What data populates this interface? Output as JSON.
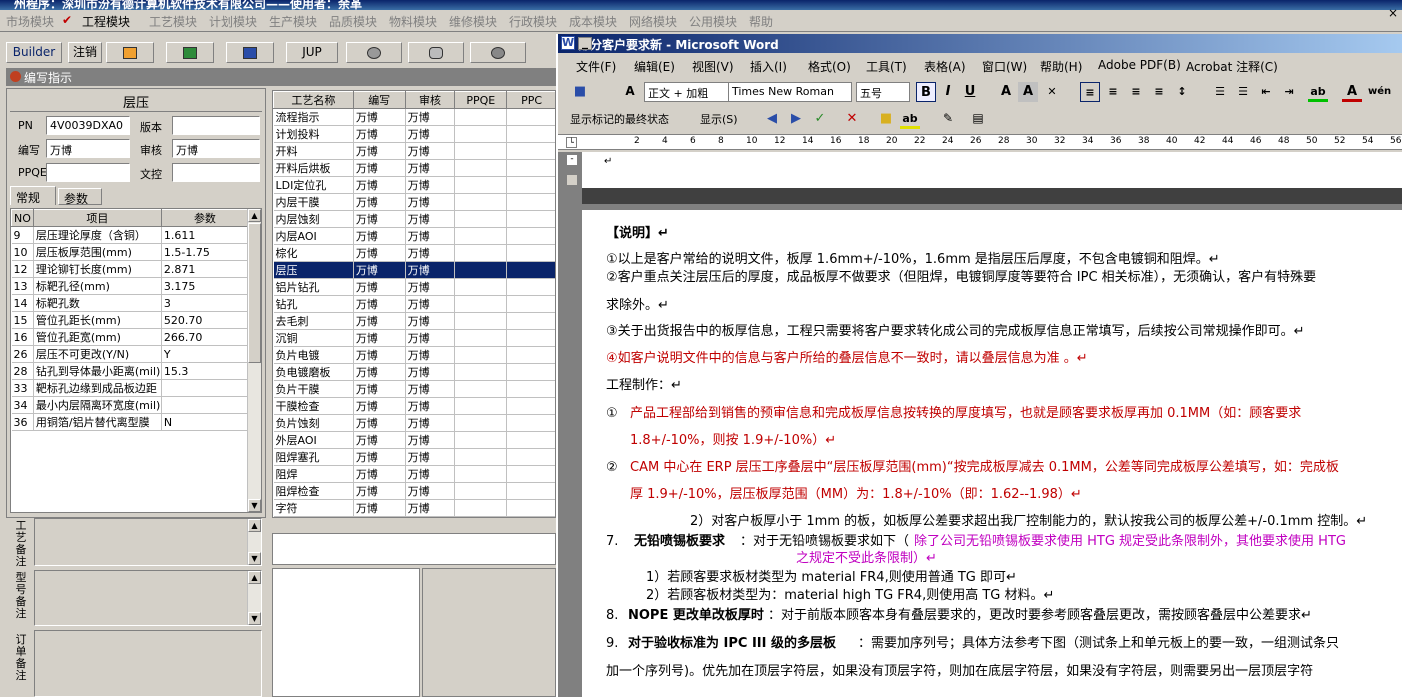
{
  "app": {
    "title": "州程序：深圳市汾有德计算机软件技术有限公司——使用者：余革",
    "menu": [
      "市场模块",
      "工程模块",
      "工艺模块",
      "计划模块",
      "生产模块",
      "品质模块",
      "物料模块",
      "维修模块",
      "行政模块",
      "成本模块",
      "网络模块",
      "公用模块",
      "帮助"
    ],
    "checked_menu": "✔",
    "toolbar": [
      "Builder",
      "注销",
      "",
      "",
      "",
      "JUP",
      "",
      "",
      ""
    ],
    "panel_title": "编写指示",
    "section_title": "层压",
    "form": {
      "pn_label": "PN",
      "pn_value": "4V0039DXA0",
      "version_label": "版本",
      "version_value": "",
      "writer_label": "编写",
      "writer_value": "万博",
      "review_label": "审核",
      "review_value": "万博",
      "ppqe_label": "PPQE",
      "ppqe_value": "",
      "doc_label": "文控",
      "doc_value": ""
    },
    "tabs": [
      "常规",
      "参数"
    ],
    "params_headers": [
      "NO",
      "项目",
      "参数"
    ],
    "params": [
      {
        "no": "9",
        "item": "层压理论厚度（含铜）",
        "value": "1.611"
      },
      {
        "no": "10",
        "item": "层压板厚范围(mm)",
        "value": "1.5-1.75"
      },
      {
        "no": "12",
        "item": "理论铆钉长度(mm)",
        "value": "2.871"
      },
      {
        "no": "13",
        "item": "标靶孔径(mm)",
        "value": "3.175"
      },
      {
        "no": "14",
        "item": "标靶孔数",
        "value": "3"
      },
      {
        "no": "15",
        "item": "管位孔距长(mm)",
        "value": "520.70"
      },
      {
        "no": "16",
        "item": "管位孔距宽(mm)",
        "value": "266.70"
      },
      {
        "no": "26",
        "item": "层压不可更改(Y/N)",
        "value": "Y"
      },
      {
        "no": "28",
        "item": "钻孔到导体最小距离(mil)",
        "value": "15.3"
      },
      {
        "no": "33",
        "item": "靶标孔边缘到成品板边距",
        "value": ""
      },
      {
        "no": "34",
        "item": "最小内层隔离环宽度(mil)",
        "value": ""
      },
      {
        "no": "36",
        "item": "用铜箔/铝片替代离型膜",
        "value": "N"
      }
    ],
    "memo_labels": [
      "工艺备注",
      "型号备注",
      "订单备注"
    ],
    "process_headers": [
      "工艺名称",
      "编写",
      "审核",
      "PPQE",
      "PPC"
    ],
    "process_rows": [
      [
        "流程指示",
        "万博",
        "万博"
      ],
      [
        "计划投料",
        "万博",
        "万博"
      ],
      [
        "开料",
        "万博",
        "万博"
      ],
      [
        "开料后烘板",
        "万博",
        "万博"
      ],
      [
        "LDI定位孔",
        "万博",
        "万博"
      ],
      [
        "内层干膜",
        "万博",
        "万博"
      ],
      [
        "内层蚀刻",
        "万博",
        "万博"
      ],
      [
        "内层AOI",
        "万博",
        "万博"
      ],
      [
        "棕化",
        "万博",
        "万博"
      ],
      [
        "层压",
        "万博",
        "万博"
      ],
      [
        "铝片钻孔",
        "万博",
        "万博"
      ],
      [
        "钻孔",
        "万博",
        "万博"
      ],
      [
        "去毛刺",
        "万博",
        "万博"
      ],
      [
        "沉铜",
        "万博",
        "万博"
      ],
      [
        "负片电镀",
        "万博",
        "万博"
      ],
      [
        "负电镀磨板",
        "万博",
        "万博"
      ],
      [
        "负片干膜",
        "万博",
        "万博"
      ],
      [
        "干膜检查",
        "万博",
        "万博"
      ],
      [
        "负片蚀刻",
        "万博",
        "万博"
      ],
      [
        "外层AOI",
        "万博",
        "万博"
      ],
      [
        "阻焊塞孔",
        "万博",
        "万博"
      ],
      [
        "阻焊",
        "万博",
        "万博"
      ],
      [
        "阻焊检查",
        "万博",
        "万博"
      ],
      [
        "字符",
        "万博",
        "万博"
      ]
    ],
    "selected_row": 9
  },
  "word": {
    "title": "部分客户要求新 - Microsoft Word",
    "menu": [
      "文件(F)",
      "编辑(E)",
      "视图(V)",
      "插入(I)",
      "格式(O)",
      "工具(T)",
      "表格(A)",
      "窗口(W)",
      "帮助(H)",
      "Adobe PDF(B)",
      "Acrobat 注释(C)"
    ],
    "style_value": "正文 + 加粗",
    "font_value": "Times New Roman",
    "size_value": "五号",
    "markup_value": "显示标记的最终状态",
    "show_label": "显示(S)",
    "ruler": [
      "2",
      "4",
      "6",
      "8",
      "10",
      "12",
      "14",
      "16",
      "18",
      "20",
      "22",
      "24",
      "26",
      "28",
      "30",
      "32",
      "34",
      "36",
      "38",
      "40",
      "42",
      "44",
      "46",
      "48",
      "50",
      "52",
      "54",
      "56"
    ],
    "colors": {
      "red": "#c00000",
      "magenta": "#c000c0"
    },
    "lines": {
      "l1": "【说明】↵",
      "l2": "①以上是客户常给的说明文件，板厚 1.6mm+/-10%，1.6mm 是指层压后厚度，不包含电镀铜和阻焊。↵",
      "l3": "②客户重点关注层压后的厚度，成品板厚不做要求（但阻焊，电镀铜厚度等要符合 IPC 相关标准），无须确认，客户有特殊要",
      "l4": "求除外。↵",
      "l5": "③关于出货报告中的板厚信息，工程只需要将客户要求转化成公司的完成板厚信息正常填写，后续按公司常规操作即可。↵",
      "l6": "④如客户说明文件中的信息与客户所给的叠层信息不一致时，请以叠层信息为准 。↵",
      "l7": "工程制作：↵",
      "l8a": "①",
      "l8b": "产品工程部给到销售的预审信息和完成板厚信息按转换的厚度填写，也就是顾客要求板厚再加 0.1MM（如：顾客要求",
      "l9": "1.8+/-10%，则按 1.9+/-10%）↵",
      "l10a": "②",
      "l10b": "CAM 中心在 ERP 层压工序叠层中“层压板厚范围(mm)“按完成板厚减去 0.1MM，公差等同完成板厚公差填写，如：完成板",
      "l11": "厚 1.9+/-10%，层压板厚范围（MM）为：1.8+/-10%（即：1.62--1.98）↵",
      "l12": "2）对客户板厚小于 1mm 的板，如板厚公差要求超出我厂控制能力的，默认按我公司的板厚公差+/-0.1mm 控制。↵",
      "l13a": "7.",
      "l13b": "无铅喷锡板要求",
      "l13c": "：对于无铅喷锡板要求如下（",
      "l13d": "除了公司无铅喷锡板要求使用 HTG 规定受此条限制外，其他要求使用 HTG",
      "l14": "之规定不受此条限制）↵",
      "l15": "1）若顾客要求板材类型为 material FR4,则使用普通 TG 即可↵",
      "l16": "2）若顾客板材类型为：material high TG FR4,则使用高 TG 材料。↵",
      "l17a": "8.",
      "l17b": "NOPE 更改单改板厚时",
      "l17c": "：对于前版本顾客本身有叠层要求的，更改时要参考顾客叠层更改，需按顾客叠层中公差要求↵",
      "l18a": "9.",
      "l18b": "对于验收标准为 IPC III 级的多层板",
      "l18c": "：需要加序列号；具体方法参考下图（测试条上和单元板上的要一致，一组测试条只",
      "l19": "加一个序列号)。优先加在顶层字符层，如果没有顶层字符，则加在底层字符层，如果没有字符层，则需要另出一层顶层字符"
    }
  }
}
